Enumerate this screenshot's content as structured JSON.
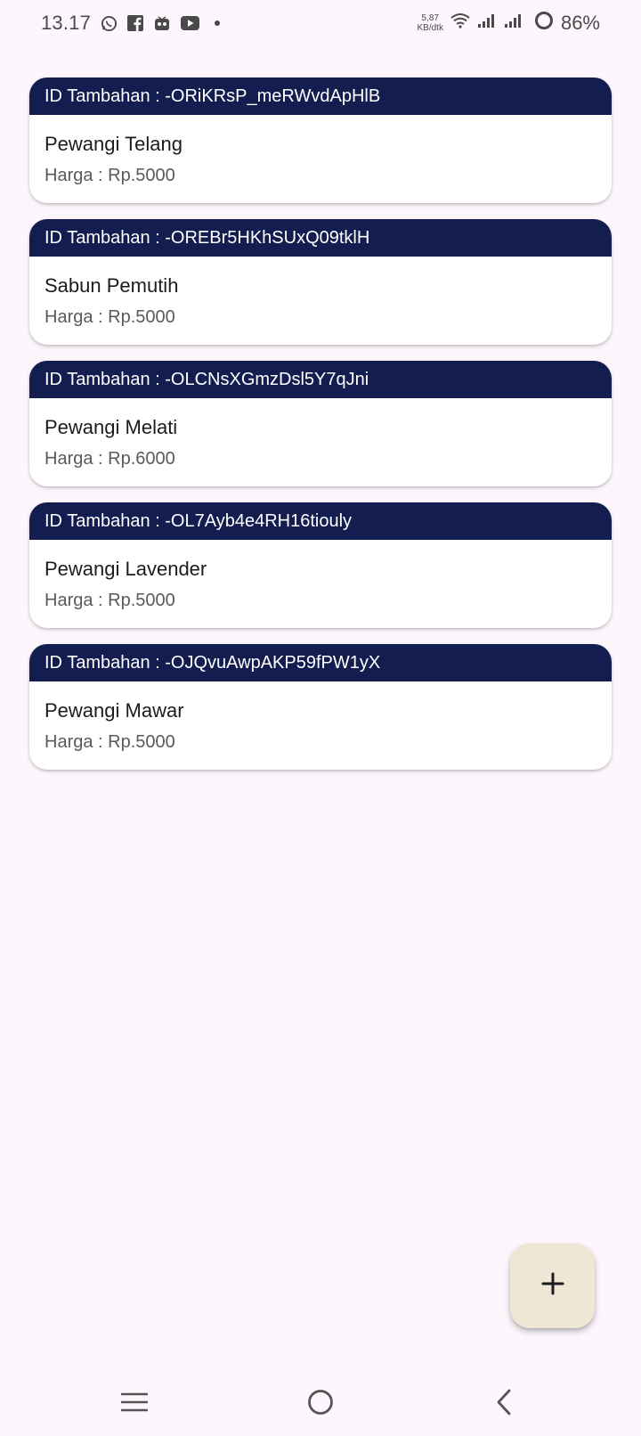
{
  "status_bar": {
    "time": "13.17",
    "net_speed_value": "5,87",
    "net_speed_unit": "KB/dtk",
    "battery": "86%"
  },
  "items": [
    {
      "header": "ID Tambahan : -ORiKRsP_meRWvdApHlB",
      "name": "Pewangi Telang",
      "price": "Harga : Rp.5000"
    },
    {
      "header": "ID Tambahan : -OREBr5HKhSUxQ09tklH",
      "name": "Sabun Pemutih",
      "price": "Harga : Rp.5000"
    },
    {
      "header": "ID Tambahan : -OLCNsXGmzDsl5Y7qJni",
      "name": "Pewangi Melati",
      "price": "Harga : Rp.6000"
    },
    {
      "header": "ID Tambahan : -OL7Ayb4e4RH16tiouly",
      "name": "Pewangi Lavender",
      "price": "Harga : Rp.5000"
    },
    {
      "header": "ID Tambahan : -OJQvuAwpAKP59fPW1yX",
      "name": "Pewangi Mawar",
      "price": "Harga : Rp.5000"
    }
  ],
  "fab": {
    "icon": "plus-icon"
  },
  "colors": {
    "background": "#fdf7fd",
    "card_header": "#141d4f",
    "fab": "#efe6d6"
  }
}
